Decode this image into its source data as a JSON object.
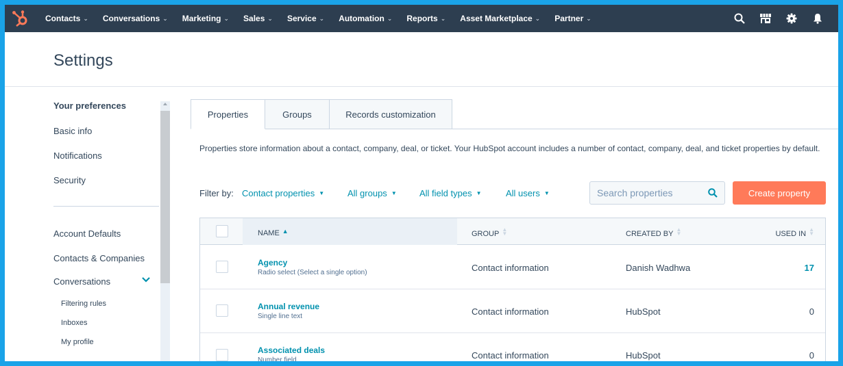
{
  "nav": {
    "items": [
      {
        "label": "Contacts"
      },
      {
        "label": "Conversations"
      },
      {
        "label": "Marketing"
      },
      {
        "label": "Sales"
      },
      {
        "label": "Service"
      },
      {
        "label": "Automation"
      },
      {
        "label": "Reports"
      },
      {
        "label": "Asset Marketplace"
      },
      {
        "label": "Partner"
      }
    ],
    "icons": [
      "search-icon",
      "marketplace-icon",
      "gear-icon",
      "bell-icon"
    ],
    "logo": "hubspot-logo"
  },
  "page": {
    "title": "Settings"
  },
  "sidebar": {
    "section_title": "Your preferences",
    "preferences": [
      "Basic info",
      "Notifications",
      "Security"
    ],
    "account": [
      "Account Defaults",
      "Contacts & Companies",
      "Conversations"
    ],
    "conversations_sub": [
      "Filtering rules",
      "Inboxes",
      "My profile"
    ]
  },
  "tabs": [
    "Properties",
    "Groups",
    "Records customization"
  ],
  "description": "Properties store information about a contact, company, deal, or ticket. Your HubSpot account includes a number of contact, company, deal, and ticket properties by default.",
  "filters": {
    "label": "Filter by:",
    "object": "Contact properties",
    "groups": "All groups",
    "field_types": "All field types",
    "users": "All users"
  },
  "search": {
    "placeholder": "Search properties"
  },
  "create_button": "Create property",
  "table": {
    "headers": {
      "name": "NAME",
      "group": "GROUP",
      "created_by": "CREATED BY",
      "used_in": "USED IN"
    },
    "rows": [
      {
        "name": "Agency",
        "type": "Radio select (Select a single option)",
        "group": "Contact information",
        "created_by": "Danish Wadhwa",
        "used_in": "17"
      },
      {
        "name": "Annual revenue",
        "type": "Single line text",
        "group": "Contact information",
        "created_by": "HubSpot",
        "used_in": "0"
      },
      {
        "name": "Associated deals",
        "type": "Number field",
        "group": "Contact information",
        "created_by": "HubSpot",
        "used_in": "0"
      }
    ]
  },
  "colors": {
    "nav_bg": "#2d3e50",
    "accent": "#0091ae",
    "primary_button": "#ff7a59",
    "logo": "#ff7a59",
    "frame_border": "#1aa3e8"
  }
}
